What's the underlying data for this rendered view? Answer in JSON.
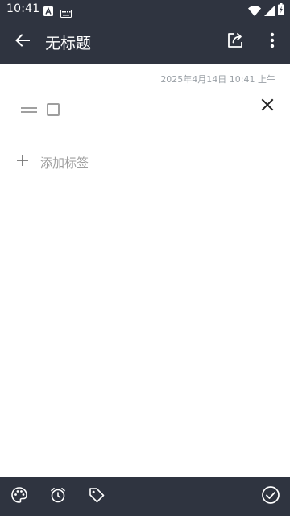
{
  "status_bar": {
    "time": "10:41",
    "icons": [
      "notification-a-icon",
      "keyboard-icon",
      "wifi-icon",
      "signal-icon",
      "battery-icon"
    ]
  },
  "app_bar": {
    "title": "无标题",
    "back_icon": "arrow-back-icon",
    "share_icon": "share-icon",
    "more_icon": "more-vert-icon"
  },
  "note": {
    "timestamp": "2025年4月14日 10:41 上午",
    "checklist_items": [
      {
        "checked": false,
        "text": ""
      }
    ]
  },
  "tags": {
    "add_label": "添加标签"
  },
  "bottom_bar": {
    "actions": [
      "palette-icon",
      "alarm-icon",
      "tag-icon",
      "check-circle-icon"
    ]
  },
  "colors": {
    "bar_background": "#2f3440",
    "content_background": "#ffffff",
    "muted_text": "#9e9e9e"
  }
}
